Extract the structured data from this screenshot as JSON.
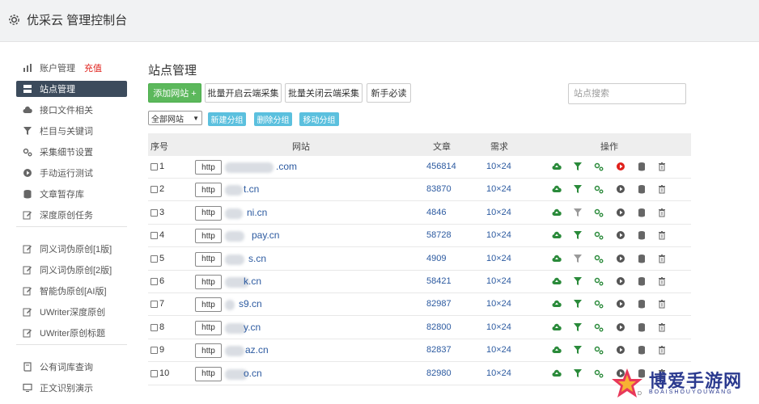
{
  "header": {
    "title": "优采云 管理控制台",
    "icon": "gear-icon"
  },
  "sidebar": {
    "items": [
      {
        "label": "账户管理",
        "highlight": "充值",
        "icon": "bar-chart-icon",
        "active": false
      },
      {
        "label": "站点管理",
        "highlight": "",
        "icon": "server-icon",
        "active": true
      },
      {
        "label": "接口文件相关",
        "highlight": "",
        "icon": "cloud-icon",
        "active": false
      },
      {
        "label": "栏目与关键词",
        "highlight": "",
        "icon": "filter-icon",
        "active": false
      },
      {
        "label": "采集细节设置",
        "highlight": "",
        "icon": "cogs-icon",
        "active": false
      },
      {
        "label": "手动运行测试",
        "highlight": "",
        "icon": "play-icon",
        "active": false
      },
      {
        "label": "文章暂存库",
        "highlight": "",
        "icon": "database-icon",
        "active": false
      },
      {
        "label": "深度原创任务",
        "highlight": "",
        "icon": "edit-icon",
        "active": false
      },
      {
        "label": "同义词伪原创[1版]",
        "highlight": "",
        "icon": "edit-icon",
        "active": false
      },
      {
        "label": "同义词伪原创[2版]",
        "highlight": "",
        "icon": "edit-icon",
        "active": false
      },
      {
        "label": "智能伪原创[AI版]",
        "highlight": "",
        "icon": "edit-icon",
        "active": false
      },
      {
        "label": "UWriter深度原创",
        "highlight": "",
        "icon": "edit-icon",
        "active": false
      },
      {
        "label": "UWriter原创标题",
        "highlight": "",
        "icon": "edit-icon",
        "active": false
      },
      {
        "label": "公有词库查询",
        "highlight": "",
        "icon": "book-icon",
        "active": false
      },
      {
        "label": "正文识别演示",
        "highlight": "",
        "icon": "monitor-icon",
        "active": false
      }
    ]
  },
  "main": {
    "title": "站点管理",
    "toolbar": {
      "add_label": "添加网站 +",
      "batch_open_label": "批量开启云端采集",
      "batch_close_label": "批量关闭云端采集",
      "guide_label": "新手必读"
    },
    "search": {
      "placeholder": "站点搜索",
      "value": ""
    },
    "filter": {
      "select_value": "全部网站",
      "new_group_label": "新建分组",
      "delete_group_label": "删除分组",
      "move_group_label": "移动分组"
    },
    "table": {
      "headers": [
        "序号",
        "网站",
        "文章",
        "需求",
        "操作"
      ],
      "rows": [
        {
          "num": "1",
          "proto": "http",
          "site": ".com",
          "articles": "456814",
          "req": "10×24",
          "run_active": true,
          "filter_active": true
        },
        {
          "num": "2",
          "proto": "http",
          "site": "t.cn",
          "articles": "83870",
          "req": "10×24",
          "run_active": false,
          "filter_active": true
        },
        {
          "num": "3",
          "proto": "http",
          "site": "ni.cn",
          "articles": "4846",
          "req": "10×24",
          "run_active": false,
          "filter_active": false
        },
        {
          "num": "4",
          "proto": "http",
          "site": "pay.cn",
          "articles": "58728",
          "req": "10×24",
          "run_active": false,
          "filter_active": true
        },
        {
          "num": "5",
          "proto": "http",
          "site": "s.cn",
          "articles": "4909",
          "req": "10×24",
          "run_active": false,
          "filter_active": false
        },
        {
          "num": "6",
          "proto": "http",
          "site": "k.cn",
          "articles": "58421",
          "req": "10×24",
          "run_active": false,
          "filter_active": true
        },
        {
          "num": "7",
          "proto": "http",
          "site": "s9.cn",
          "articles": "82987",
          "req": "10×24",
          "run_active": false,
          "filter_active": true
        },
        {
          "num": "8",
          "proto": "http",
          "site": "y.cn",
          "articles": "82800",
          "req": "10×24",
          "run_active": false,
          "filter_active": true
        },
        {
          "num": "9",
          "proto": "http",
          "site": "az.cn",
          "articles": "82837",
          "req": "10×24",
          "run_active": false,
          "filter_active": true
        },
        {
          "num": "10",
          "proto": "http",
          "site": "o.cn",
          "articles": "82980",
          "req": "10×24",
          "run_active": false,
          "filter_active": true
        }
      ]
    }
  },
  "watermark": {
    "text": "博爱手游网",
    "sub": "BOAISHOUYOUWANG",
    "prefix": "D"
  },
  "colors": {
    "accent_dark": "#3c4b5c",
    "add_green": "#5cb85c",
    "info_blue": "#5bc0de",
    "link_blue": "#2c5aa0",
    "icon_green": "#2a8a3a",
    "run_red": "#e0201b"
  }
}
